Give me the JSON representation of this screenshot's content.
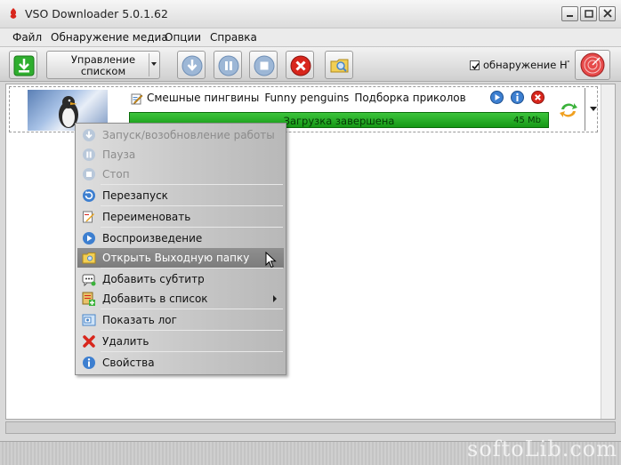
{
  "window": {
    "title": "VSO Downloader 5.0.1.62"
  },
  "menu": [
    "Файл",
    "Обнаружение медиа",
    "Опции",
    "Справка"
  ],
  "toolbar": {
    "list_button_line1": "Управление",
    "list_button_line2": "списком",
    "detect_label": "обнаружение HTTP",
    "detect_checked": true
  },
  "download": {
    "title_parts": [
      "Смешные пингвины",
      "Funny penguins",
      "Подборка приколов"
    ],
    "status": "Загрузка завершена",
    "size": "45 Mb",
    "progress": 1.0
  },
  "context_menu": [
    {
      "label": "Запуск/возобновление работы",
      "icon": "download-icon",
      "disabled": true
    },
    {
      "label": "Пауза",
      "icon": "pause-icon",
      "disabled": true
    },
    {
      "label": "Стоп",
      "icon": "stop-icon",
      "disabled": true
    },
    {
      "label": "Перезапуск",
      "icon": "restart-icon",
      "disabled": false,
      "sep_before": true
    },
    {
      "label": "Переименовать",
      "icon": "rename-icon",
      "disabled": false,
      "sep_before": true
    },
    {
      "label": "Воспроизведение",
      "icon": "play-icon",
      "disabled": false,
      "sep_before": true
    },
    {
      "label": "Открыть Выходную папку",
      "icon": "folder-icon",
      "disabled": false,
      "hover": true
    },
    {
      "label": "Добавить субтитр",
      "icon": "subtitle-icon",
      "disabled": false,
      "sep_before": true
    },
    {
      "label": "Добавить в список",
      "icon": "add-list-icon",
      "disabled": false,
      "submenu": true
    },
    {
      "label": "Показать лог",
      "icon": "log-icon",
      "disabled": false,
      "sep_before": true
    },
    {
      "label": "Удалить",
      "icon": "delete-icon",
      "disabled": false,
      "sep_before": true
    },
    {
      "label": "Свойства",
      "icon": "info-icon",
      "disabled": false,
      "sep_before": true
    }
  ],
  "watermark": "softoLib.com",
  "colors": {
    "progress_green": "#22b022",
    "accent_red": "#d8261c",
    "toolbar_blue": "#4a86c8"
  }
}
